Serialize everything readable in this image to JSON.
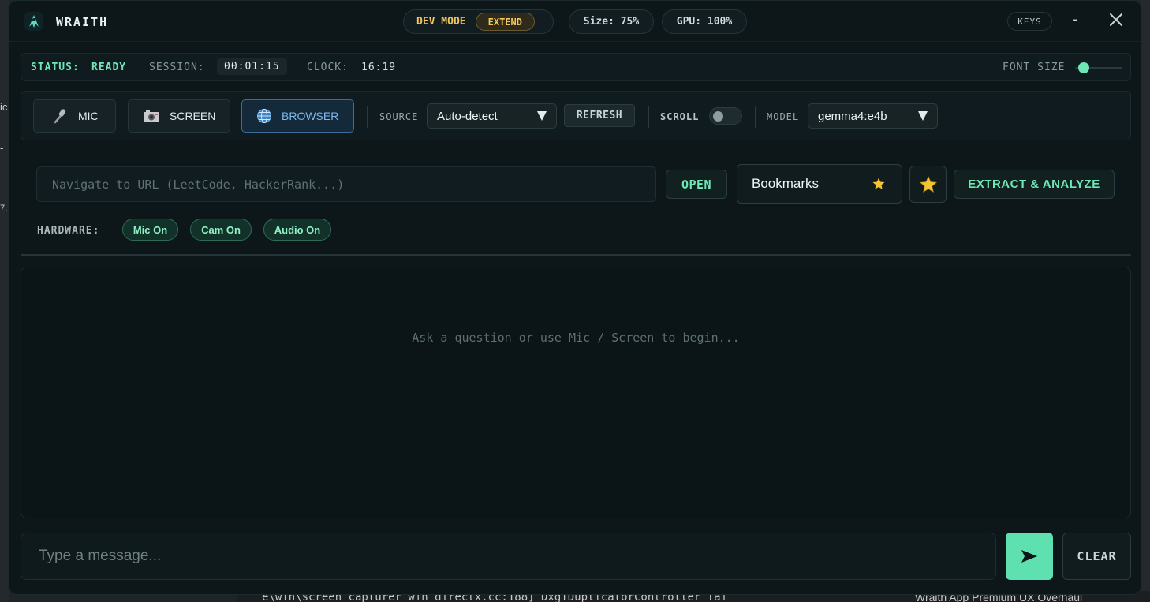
{
  "titlebar": {
    "title": "WRAITH",
    "dev_mode_label": "DEV MODE",
    "extend_label": "EXTEND",
    "size_label": "Size: 75%",
    "gpu_label": "GPU: 100%",
    "keys_label": "KEYS",
    "minimize_label": "-"
  },
  "status": {
    "status_label": "STATUS:",
    "status_value": "READY",
    "session_label": "SESSION:",
    "session_value": "00:01:15",
    "clock_label": "CLOCK:",
    "clock_value": "16:19",
    "font_size_label": "FONT SIZE",
    "font_size_level": 0.1
  },
  "toolbar": {
    "mic_label": "MIC",
    "screen_label": "SCREEN",
    "browser_label": "BROWSER",
    "source_label": "SOURCE",
    "source_value": "Auto-detect",
    "refresh_label": "REFRESH",
    "scroll_label": "SCROLL",
    "scroll_on": false,
    "model_label": "MODEL",
    "model_value": "gemma4:e4b"
  },
  "browser": {
    "url_placeholder": "Navigate to URL (LeetCode, HackerRank...)",
    "open_label": "OPEN",
    "bookmarks_label": "Bookmarks",
    "extract_label": "EXTRACT & ANALYZE"
  },
  "hardware": {
    "label": "HARDWARE:",
    "chips": [
      "Mic On",
      "Cam On",
      "Audio On"
    ]
  },
  "chat": {
    "empty_text": "Ask a question or use Mic / Screen to begin...",
    "input_placeholder": "Type a message...",
    "clear_label": "CLEAR"
  },
  "background": {
    "left_fragments": [
      "ic",
      "-",
      "7.!"
    ],
    "code_fragment": "e\\win\\screen_capturer_win_directx.cc:188] DxgiDuplicatorController fai",
    "note_fragment": "Wraith App Premium UX Overhaul"
  },
  "colors": {
    "accent": "#6ee7b7",
    "warning": "#f2c75c",
    "active_blue": "#7cb8ec",
    "window_bg": "#0d1719"
  }
}
